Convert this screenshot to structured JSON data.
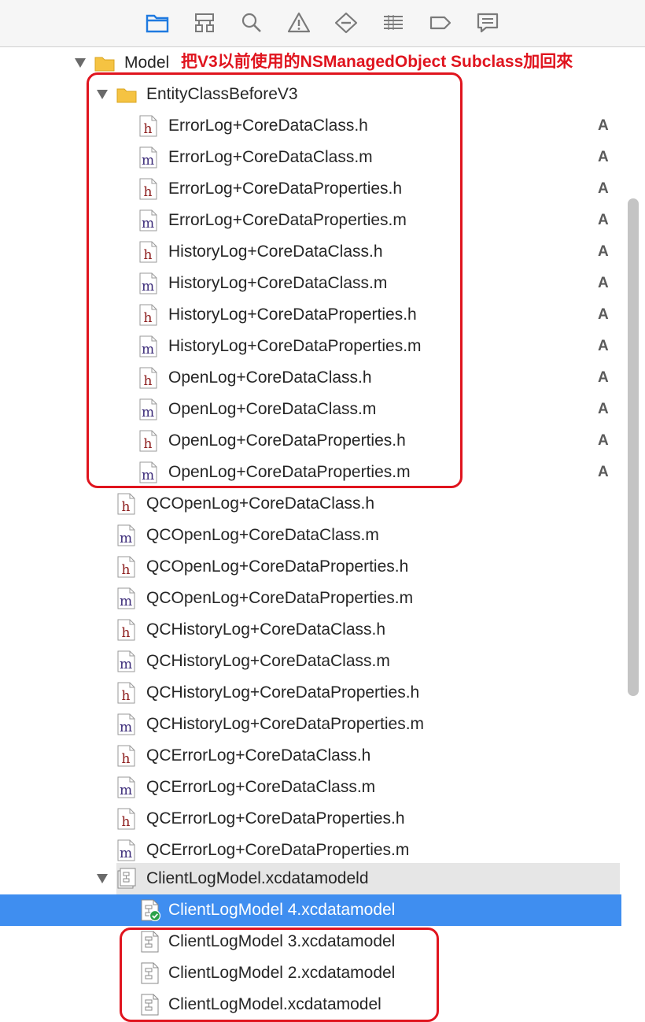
{
  "toolbar": {
    "icons": [
      "project-navigator-icon",
      "symbol-navigator-icon",
      "find-navigator-icon",
      "issue-navigator-icon",
      "test-navigator-icon",
      "debug-navigator-icon",
      "breakpoint-navigator-icon",
      "report-navigator-icon"
    ]
  },
  "model_group": {
    "name": "Model",
    "annotation": "把V3以前使用的NSManagedObject Subclass加回來"
  },
  "entity_group": {
    "name": "EntityClassBeforeV3",
    "files": [
      {
        "name": "ErrorLog+CoreDataClass.h",
        "type": "h",
        "badge": "A"
      },
      {
        "name": "ErrorLog+CoreDataClass.m",
        "type": "m",
        "badge": "A"
      },
      {
        "name": "ErrorLog+CoreDataProperties.h",
        "type": "h",
        "badge": "A"
      },
      {
        "name": "ErrorLog+CoreDataProperties.m",
        "type": "m",
        "badge": "A"
      },
      {
        "name": "HistoryLog+CoreDataClass.h",
        "type": "h",
        "badge": "A"
      },
      {
        "name": "HistoryLog+CoreDataClass.m",
        "type": "m",
        "badge": "A"
      },
      {
        "name": "HistoryLog+CoreDataProperties.h",
        "type": "h",
        "badge": "A"
      },
      {
        "name": "HistoryLog+CoreDataProperties.m",
        "type": "m",
        "badge": "A"
      },
      {
        "name": "OpenLog+CoreDataClass.h",
        "type": "h",
        "badge": "A"
      },
      {
        "name": "OpenLog+CoreDataClass.m",
        "type": "m",
        "badge": "A"
      },
      {
        "name": "OpenLog+CoreDataProperties.h",
        "type": "h",
        "badge": "A"
      },
      {
        "name": "OpenLog+CoreDataProperties.m",
        "type": "m",
        "badge": "A"
      }
    ]
  },
  "model_files": [
    {
      "name": "QCOpenLog+CoreDataClass.h",
      "type": "h"
    },
    {
      "name": "QCOpenLog+CoreDataClass.m",
      "type": "m"
    },
    {
      "name": "QCOpenLog+CoreDataProperties.h",
      "type": "h"
    },
    {
      "name": "QCOpenLog+CoreDataProperties.m",
      "type": "m"
    },
    {
      "name": "QCHistoryLog+CoreDataClass.h",
      "type": "h"
    },
    {
      "name": "QCHistoryLog+CoreDataClass.m",
      "type": "m"
    },
    {
      "name": "QCHistoryLog+CoreDataProperties.h",
      "type": "h"
    },
    {
      "name": "QCHistoryLog+CoreDataProperties.m",
      "type": "m"
    },
    {
      "name": "QCErrorLog+CoreDataClass.h",
      "type": "h"
    },
    {
      "name": "QCErrorLog+CoreDataClass.m",
      "type": "m"
    },
    {
      "name": "QCErrorLog+CoreDataProperties.h",
      "type": "h"
    },
    {
      "name": "QCErrorLog+CoreDataProperties.m",
      "type": "m"
    }
  ],
  "datamodel_group": {
    "name": "ClientLogModel.xcdatamodeld",
    "versions": [
      {
        "name": "ClientLogModel 4.xcdatamodel",
        "selected": true,
        "current": true
      },
      {
        "name": "ClientLogModel 3.xcdatamodel",
        "selected": false,
        "current": false
      },
      {
        "name": "ClientLogModel 2.xcdatamodel",
        "selected": false,
        "current": false
      },
      {
        "name": "ClientLogModel.xcdatamodel",
        "selected": false,
        "current": false
      }
    ]
  },
  "colors": {
    "selection": "#3f8ef0",
    "annotation_red": "#e0141e",
    "folder_yellow": "#f5c342",
    "toolbar_blue": "#1f7ae0",
    "h_letter": "#8b1a1a",
    "m_letter": "#3a2a78"
  }
}
